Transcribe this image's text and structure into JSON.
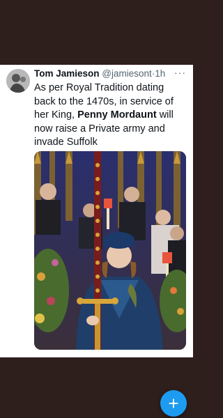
{
  "tweet": {
    "author_name": "Tom Jamieson",
    "author_handle": "@jamiesont",
    "separator": "·",
    "time": "1h",
    "more_label": "···",
    "text_before": "As per Royal Tradition dating back to the 1470s, in service of her King, ",
    "text_bold": "Penny Mordaunt",
    "text_after": " will now raise a Private army and invade Suffolk"
  },
  "fab": {
    "icon": "plus-icon",
    "label": "+",
    "color": "#1d9bf0"
  },
  "colors": {
    "background": "#2e1e1c",
    "card": "#ffffff",
    "accent": "#1d9bf0"
  }
}
